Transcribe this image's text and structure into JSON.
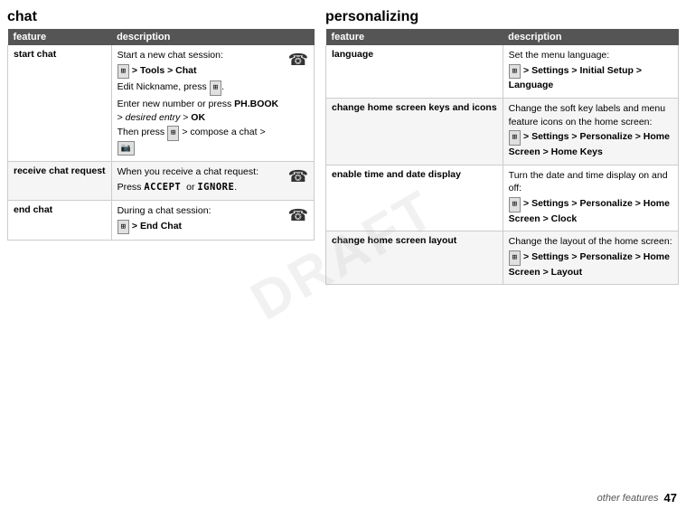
{
  "left": {
    "title": "chat",
    "table": {
      "headers": [
        "feature",
        "description"
      ],
      "rows": [
        {
          "feature": "start chat",
          "description_parts": [
            {
              "type": "text",
              "text": "Start a new chat session:"
            },
            {
              "type": "menu",
              "text": "⊞ > Tools > Chat"
            },
            {
              "type": "text",
              "text": "Edit Nickname, press ⊞."
            },
            {
              "type": "text-bold",
              "text": "Enter new number or press PH.BOOK > desired entry > OK"
            },
            {
              "type": "text",
              "text": "Then press ⊞ > compose a chat > 📷"
            },
            {
              "type": "has_icon",
              "icon": "☺"
            }
          ]
        },
        {
          "feature": "receive chat request",
          "description_parts": [
            {
              "type": "text",
              "text": "When you receive a chat request:"
            },
            {
              "type": "text",
              "text": "Press ACCEPT  or IGNORE."
            },
            {
              "type": "has_icon",
              "icon": "☺"
            }
          ]
        },
        {
          "feature": "end chat",
          "description_parts": [
            {
              "type": "text",
              "text": "During a chat session:"
            },
            {
              "type": "menu",
              "text": "⊞ > End Chat"
            },
            {
              "type": "has_icon",
              "icon": "☺"
            }
          ]
        }
      ]
    }
  },
  "right": {
    "title": "personalizing",
    "table": {
      "headers": [
        "feature",
        "description"
      ],
      "rows": [
        {
          "feature": "language",
          "description_parts": [
            {
              "type": "text",
              "text": "Set the menu language:"
            },
            {
              "type": "menu",
              "text": "⊞ > Settings > Initial Setup > Language"
            }
          ]
        },
        {
          "feature": "change home screen keys and icons",
          "description_parts": [
            {
              "type": "text",
              "text": "Change the soft key labels and menu feature icons on the home screen:"
            },
            {
              "type": "menu",
              "text": "⊞ > Settings > Personalize > Home Screen > Home Keys"
            }
          ]
        },
        {
          "feature": "enable time and date display",
          "description_parts": [
            {
              "type": "text",
              "text": "Turn the date and time display on and off:"
            },
            {
              "type": "menu",
              "text": "⊞ > Settings > Personalize > Home Screen > Clock"
            }
          ]
        },
        {
          "feature": "change home screen layout",
          "description_parts": [
            {
              "type": "text",
              "text": "Change the layout of the home screen:"
            },
            {
              "type": "menu",
              "text": "⊞ > Settings > Personalize > Home Screen > Layout"
            }
          ]
        }
      ]
    }
  },
  "footer": {
    "label": "other features",
    "page": "47"
  },
  "watermark": "DRAFT"
}
